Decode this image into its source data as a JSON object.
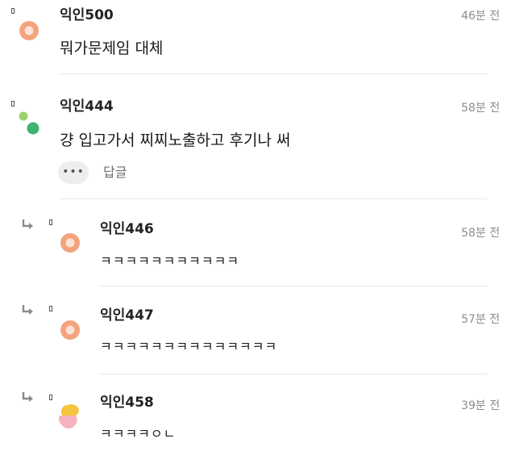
{
  "comments": [
    {
      "author": "익인500",
      "time": "46분 전",
      "text": "뭐가문제임 대체"
    },
    {
      "author": "익인444",
      "time": "58분 전",
      "text": "걍 입고가서 찌찌노출하고 후기나 써",
      "more_label": "•••",
      "reply_label": "답글"
    }
  ],
  "replies": [
    {
      "author": "익인446",
      "time": "58분 전",
      "text": "ㅋㅋㅋㅋㅋㅋㅋㅋㅋㅋㅋ"
    },
    {
      "author": "익인447",
      "time": "57분 전",
      "text": "ㅋㅋㅋㅋㅋㅋㅋㅋㅋㅋㅋㅋㅋㅋ"
    },
    {
      "author": "익인458",
      "time": "39분 전",
      "text": "ㅋㅋㅋㅋㅇㄴ"
    }
  ],
  "icons": {
    "avatar_orange": "orange-ring-avatar-icon",
    "avatar_green": "green-dots-avatar-icon",
    "avatar_yellow_pink": "yellow-pink-avatar-icon",
    "reply_arrow": "reply-arrow-icon",
    "marker": "small-square-marker-icon"
  },
  "colors": {
    "avatar_orange_outer": "#f4a37c",
    "avatar_orange_inner": "#fbe3d6",
    "avatar_green_light": "#9bd16e",
    "avatar_green_dark": "#3fb36b",
    "avatar_yellow": "#f6c53d",
    "avatar_pink": "#f5b3bf",
    "author": "#222222",
    "time": "#8c8c8c",
    "separator": "#e6e6e6",
    "button_bg": "#eeeeee"
  }
}
